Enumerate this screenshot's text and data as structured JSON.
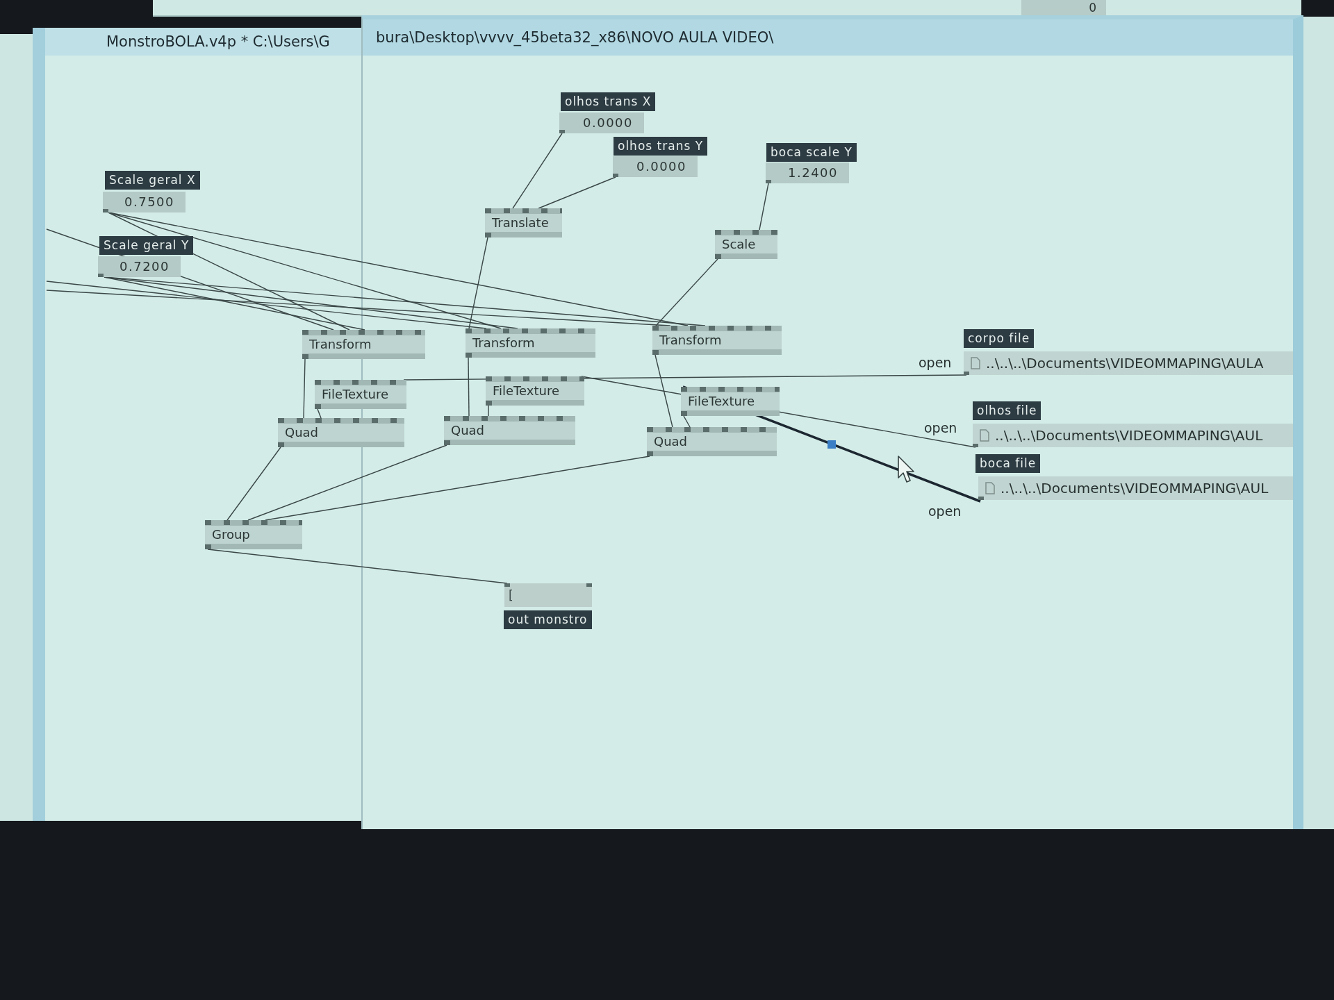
{
  "top_window": {
    "value": "0"
  },
  "back_window": {
    "title": "MonstroBOLA.v4p * C:\\Users\\G"
  },
  "front_window": {
    "title": "bura\\Desktop\\vvvv_45beta32_x86\\NOVO AULA VIDEO\\"
  },
  "value_boxes": [
    {
      "label": "Scale geral X",
      "value": "0.7500"
    },
    {
      "label": "Scale geral Y",
      "value": "0.7200"
    },
    {
      "label": "olhos trans X",
      "value": "0.0000"
    },
    {
      "label": "olhos trans Y",
      "value": "0.0000"
    },
    {
      "label": "boca scale Y",
      "value": "1.2400"
    }
  ],
  "nodes": [
    {
      "name": "Translate"
    },
    {
      "name": "Scale"
    },
    {
      "name": "Transform"
    },
    {
      "name": "Transform"
    },
    {
      "name": "Transform"
    },
    {
      "name": "FileTexture"
    },
    {
      "name": "FileTexture"
    },
    {
      "name": "FileTexture"
    },
    {
      "name": "Quad"
    },
    {
      "name": "Quad"
    },
    {
      "name": "Quad"
    },
    {
      "name": "Group"
    }
  ],
  "file_boxes": [
    {
      "label": "corpo file",
      "input": "open",
      "path": "..\\..\\..\\Documents\\VIDEOMMAPING\\AULA"
    },
    {
      "label": "olhos file",
      "input": "open",
      "path": "..\\..\\..\\Documents\\VIDEOMMAPING\\AUL"
    },
    {
      "label": "boca file",
      "input": "open",
      "path": "..\\..\\..\\Documents\\VIDEOMMAPING\\AUL"
    }
  ],
  "output_box": {
    "value": "[",
    "label": "out monstro"
  }
}
